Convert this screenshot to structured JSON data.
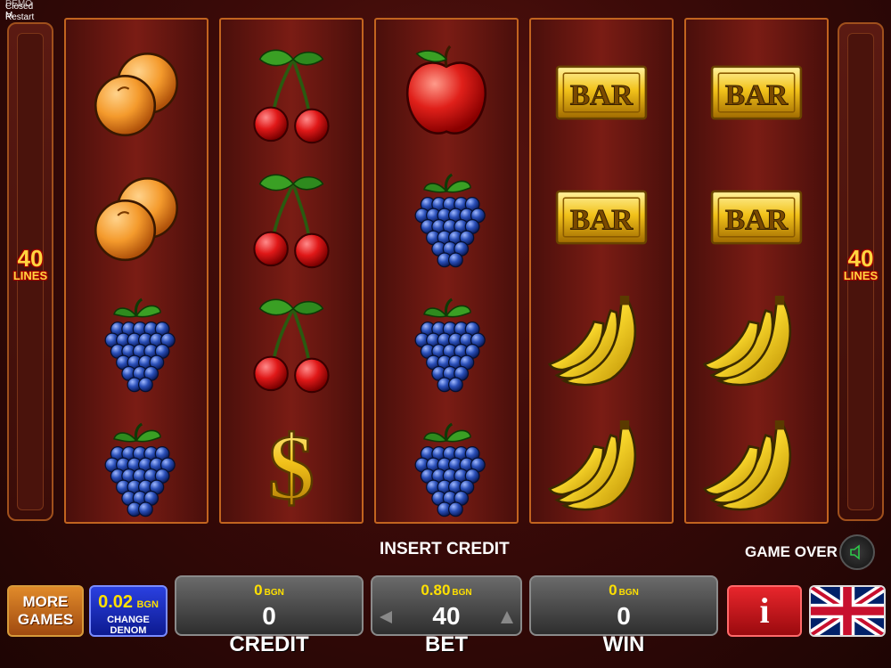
{
  "corner": {
    "line1": "DEMO",
    "line2": "Closed M",
    "line3": "Restart"
  },
  "sides": {
    "lines_count": "40",
    "lines_text": "LINES"
  },
  "reels": [
    [
      "peaches",
      "peaches",
      "grapes",
      "grapes"
    ],
    [
      "cherries",
      "cherries",
      "cherries",
      "dollar"
    ],
    [
      "apple",
      "grapes",
      "grapes",
      "grapes"
    ],
    [
      "bar",
      "bar",
      "bananas",
      "bananas"
    ],
    [
      "bar",
      "bar",
      "bananas",
      "bananas"
    ]
  ],
  "bar_text": "BAR",
  "dollar_text": "$",
  "status": {
    "insert_credit": "INSERT CREDIT",
    "game_over": "GAME OVER"
  },
  "buttons": {
    "more_games": "MORE GAMES",
    "denom_value": "0.02",
    "denom_currency": "BGN",
    "change_denom": "CHANGE DENOM",
    "info": "i"
  },
  "credit": {
    "amount": "0",
    "currency": "BGN",
    "value": "0",
    "label": "CREDIT"
  },
  "bet": {
    "amount": "0.80",
    "currency": "BGN",
    "value": "40",
    "label": "BET"
  },
  "win": {
    "amount": "0",
    "currency": "BGN",
    "value": "0",
    "label": "WIN"
  },
  "colors": {
    "accent_yellow": "#ffe000",
    "info_red": "#d4141a",
    "reel_border": "#c2641f",
    "denom_blue": "#1a2fc0"
  },
  "icons": {
    "sound": "speaker-icon",
    "language": "uk-flag-icon",
    "bet_down": "triangle-left-icon",
    "bet_up": "triangle-right-icon"
  }
}
